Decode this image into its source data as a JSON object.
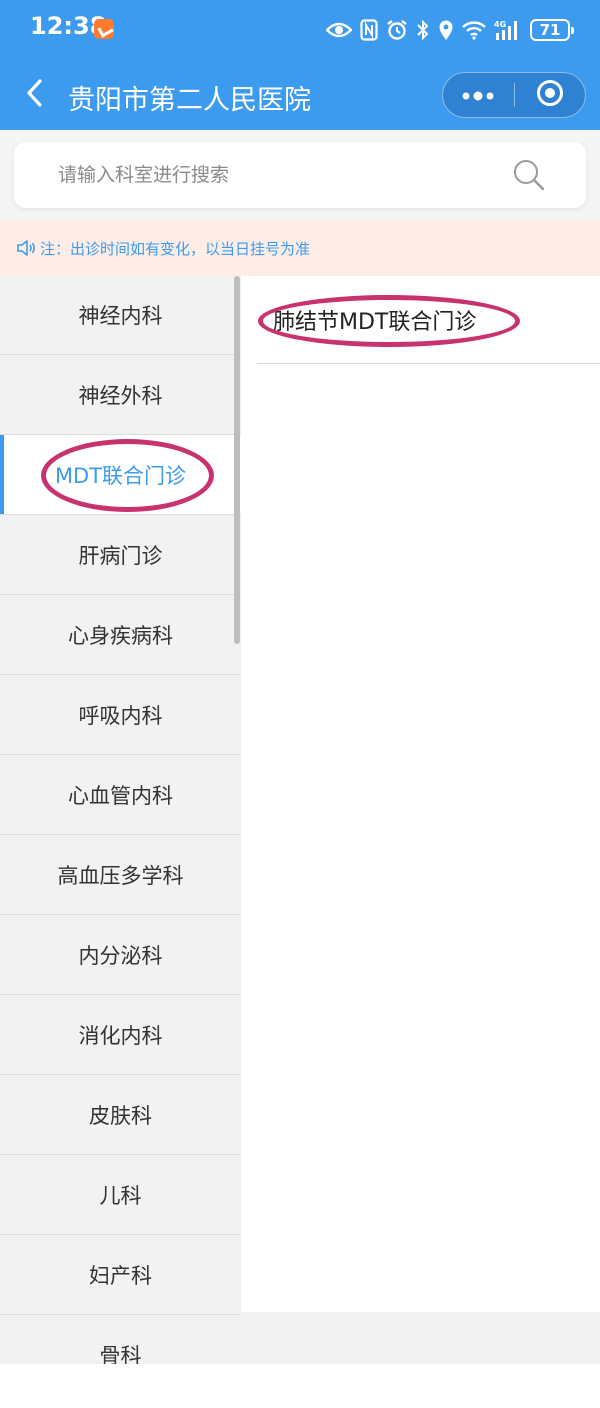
{
  "status_bar": {
    "time": "12:38",
    "battery": "71",
    "icons": [
      "eye-icon",
      "nfc-icon",
      "alarm-icon",
      "bluetooth-icon",
      "location-icon",
      "wifi-icon",
      "signal-4g-icon",
      "battery-icon"
    ]
  },
  "nav": {
    "title": "贵阳市第二人民医院",
    "back_icon": "chevron-left-icon",
    "capsule_icons": [
      "more-dots-icon",
      "close-circle-icon"
    ]
  },
  "search": {
    "placeholder": "请输入科室进行搜索",
    "icon": "search-icon"
  },
  "notice": {
    "icon": "speaker-icon",
    "text": "注：出诊时间如有变化，以当日挂号为准"
  },
  "departments": {
    "items": [
      {
        "label": "神经内科"
      },
      {
        "label": "神经外科"
      },
      {
        "label": "MDT联合门诊"
      },
      {
        "label": "肝病门诊"
      },
      {
        "label": "心身疾病科"
      },
      {
        "label": "呼吸内科"
      },
      {
        "label": "心血管内科"
      },
      {
        "label": "高血压多学科"
      },
      {
        "label": "内分泌科"
      },
      {
        "label": "消化内科"
      },
      {
        "label": "皮肤科"
      },
      {
        "label": "儿科"
      },
      {
        "label": "妇产科"
      },
      {
        "label": "骨科"
      }
    ],
    "selected": "MDT联合门诊"
  },
  "clinics": {
    "items": [
      {
        "label": "肺结节MDT联合门诊"
      }
    ]
  },
  "colors": {
    "header": "#3d9bef",
    "accent": "#3d9bef",
    "notice_bg": "#fdede6",
    "annotation": "#c8336e",
    "list_bg": "#f2f2f2"
  }
}
